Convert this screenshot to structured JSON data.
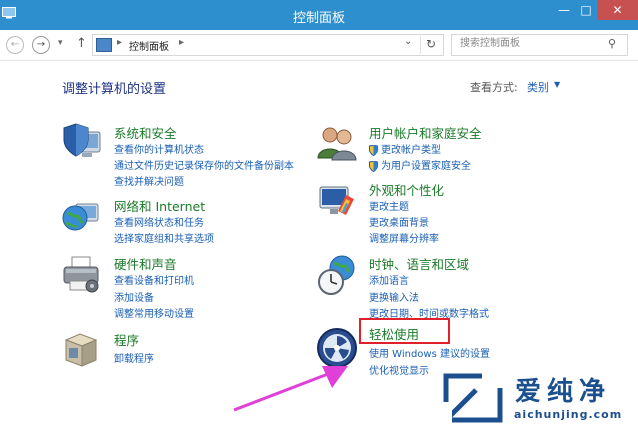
{
  "window": {
    "title": "控制面板",
    "minimize_glyph": "—",
    "maximize_glyph": "□",
    "close_glyph": "✕"
  },
  "nav": {
    "back_glyph": "←",
    "forward_glyph": "→",
    "history_glyph": "▾",
    "up_glyph": "↑",
    "address_separator": "▸",
    "address_text": "控制面板",
    "address_dropdown_glyph": "⌄",
    "refresh_glyph": "↻",
    "search_placeholder": "搜索控制面板",
    "search_glyph": "⚲"
  },
  "header": {
    "heading": "调整计算机的设置",
    "view_by_label": "查看方式:",
    "view_by_value": "类别",
    "view_by_arrow": "▼"
  },
  "categories": [
    {
      "title": "系统和安全",
      "links": [
        "查看你的计算机状态",
        "通过文件历史记录保存你的文件备份副本",
        "查找并解决问题"
      ]
    },
    {
      "title": "网络和 Internet",
      "links": [
        "查看网络状态和任务",
        "选择家庭组和共享选项"
      ]
    },
    {
      "title": "硬件和声音",
      "links": [
        "查看设备和打印机",
        "添加设备",
        "调整常用移动设置"
      ]
    },
    {
      "title": "程序",
      "links": [
        "卸载程序"
      ]
    },
    {
      "title": "用户帐户和家庭安全",
      "links": [
        "更改帐户类型",
        "为用户设置家庭安全"
      ]
    },
    {
      "title": "外观和个性化",
      "links": [
        "更改主题",
        "更改桌面背景",
        "调整屏幕分辨率"
      ]
    },
    {
      "title": "时钟、语言和区域",
      "links": [
        "添加语言",
        "更换输入法",
        "更改日期、时间或数字格式"
      ]
    },
    {
      "title": "轻松使用",
      "links": [
        "使用 Windows 建议的设置",
        "优化视觉显示"
      ]
    }
  ],
  "watermark": {
    "brand": "爱纯净",
    "url": "aichunjing.com"
  },
  "colors": {
    "titlebar": "#2e8fcf",
    "category_title": "#1a7a28",
    "link": "#1a5fb4",
    "highlight_box": "#e0202a",
    "arrow": "#e040d8",
    "watermark": "#1c4f8e"
  },
  "icons": {
    "system_security": "shield-computer-icon",
    "network": "globe-network-icon",
    "hardware": "printer-icon",
    "programs": "programs-box-icon",
    "user_accounts": "users-icon",
    "appearance": "monitor-paint-icon",
    "clock_region": "clock-globe-icon",
    "ease_of_access": "ease-of-access-icon",
    "uac": "uac-shield-icon"
  }
}
